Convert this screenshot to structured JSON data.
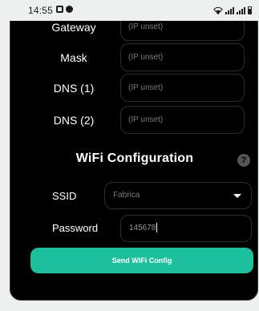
{
  "status_bar": {
    "time": "14:55",
    "left_icons": [
      "image-icon",
      "notification-dot-icon"
    ],
    "right_icons": [
      "wifi-icon",
      "signal-icon",
      "signal-icon",
      "battery-icon"
    ]
  },
  "network": {
    "rows": [
      {
        "label": "Gateway",
        "placeholder": "(IP unset)"
      },
      {
        "label": "Mask",
        "placeholder": "(IP unset)"
      },
      {
        "label": "DNS (1)",
        "placeholder": "(IP unset)"
      },
      {
        "label": "DNS (2)",
        "placeholder": "(IP unset)"
      }
    ]
  },
  "wifi": {
    "title": "WiFi Configuration",
    "help_icon": "?",
    "ssid_label": "SSID",
    "ssid_value": "Fabrica",
    "password_label": "Password",
    "password_value": "145678",
    "send_button": "Send WiFi Config"
  },
  "colors": {
    "accent": "#1dbf9c",
    "card_bg": "#000000",
    "page_bg": "#eef0ef"
  }
}
